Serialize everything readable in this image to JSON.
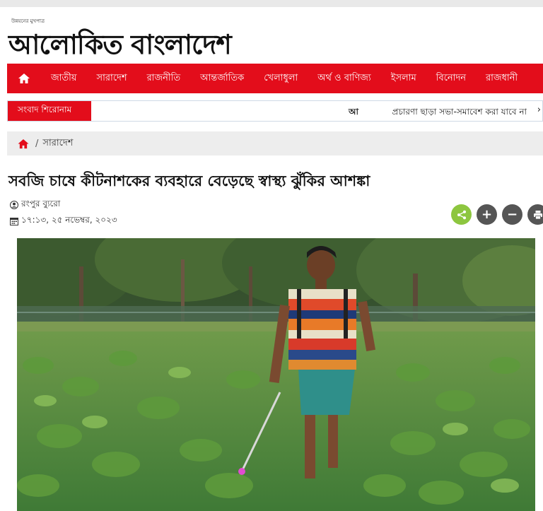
{
  "site": {
    "logo_tagline": "উন্নয়নের মুখপাত্র",
    "logo_text": "আলোকিত বাংলাদেশ",
    "brand_color": "#e30d1b"
  },
  "nav": {
    "home_icon": "home-icon",
    "items": [
      "জাতীয়",
      "সারাদেশ",
      "রাজনীতি",
      "আন্তর্জাতিক",
      "খেলাধুলা",
      "অর্থ ও বাণিজ্য",
      "ইসলাম",
      "বিনোদন",
      "রাজধানী"
    ]
  },
  "ticker": {
    "label": "সংবাদ শিরোনাম",
    "brand": "আ",
    "headline": "প্রচারণা ছাড়া সভা-সমাবেশ করা যাবে না",
    "next_glyph": "›"
  },
  "breadcrumb": {
    "separator": "/",
    "current": "সারাদেশ"
  },
  "article": {
    "headline": "সবজি চাষে কীটনাশকের ব্যবহারে বেড়েছে স্বাস্থ্য ঝুঁকির আশঙ্কা",
    "author": "রংপুর ব্যুরো",
    "datetime": "১৭:১৩, ২৫ নভেম্বর, ২০২৩"
  },
  "share": {
    "share_color": "#8dc63f",
    "control_color": "#555555",
    "plus": "+",
    "minus": "−"
  }
}
